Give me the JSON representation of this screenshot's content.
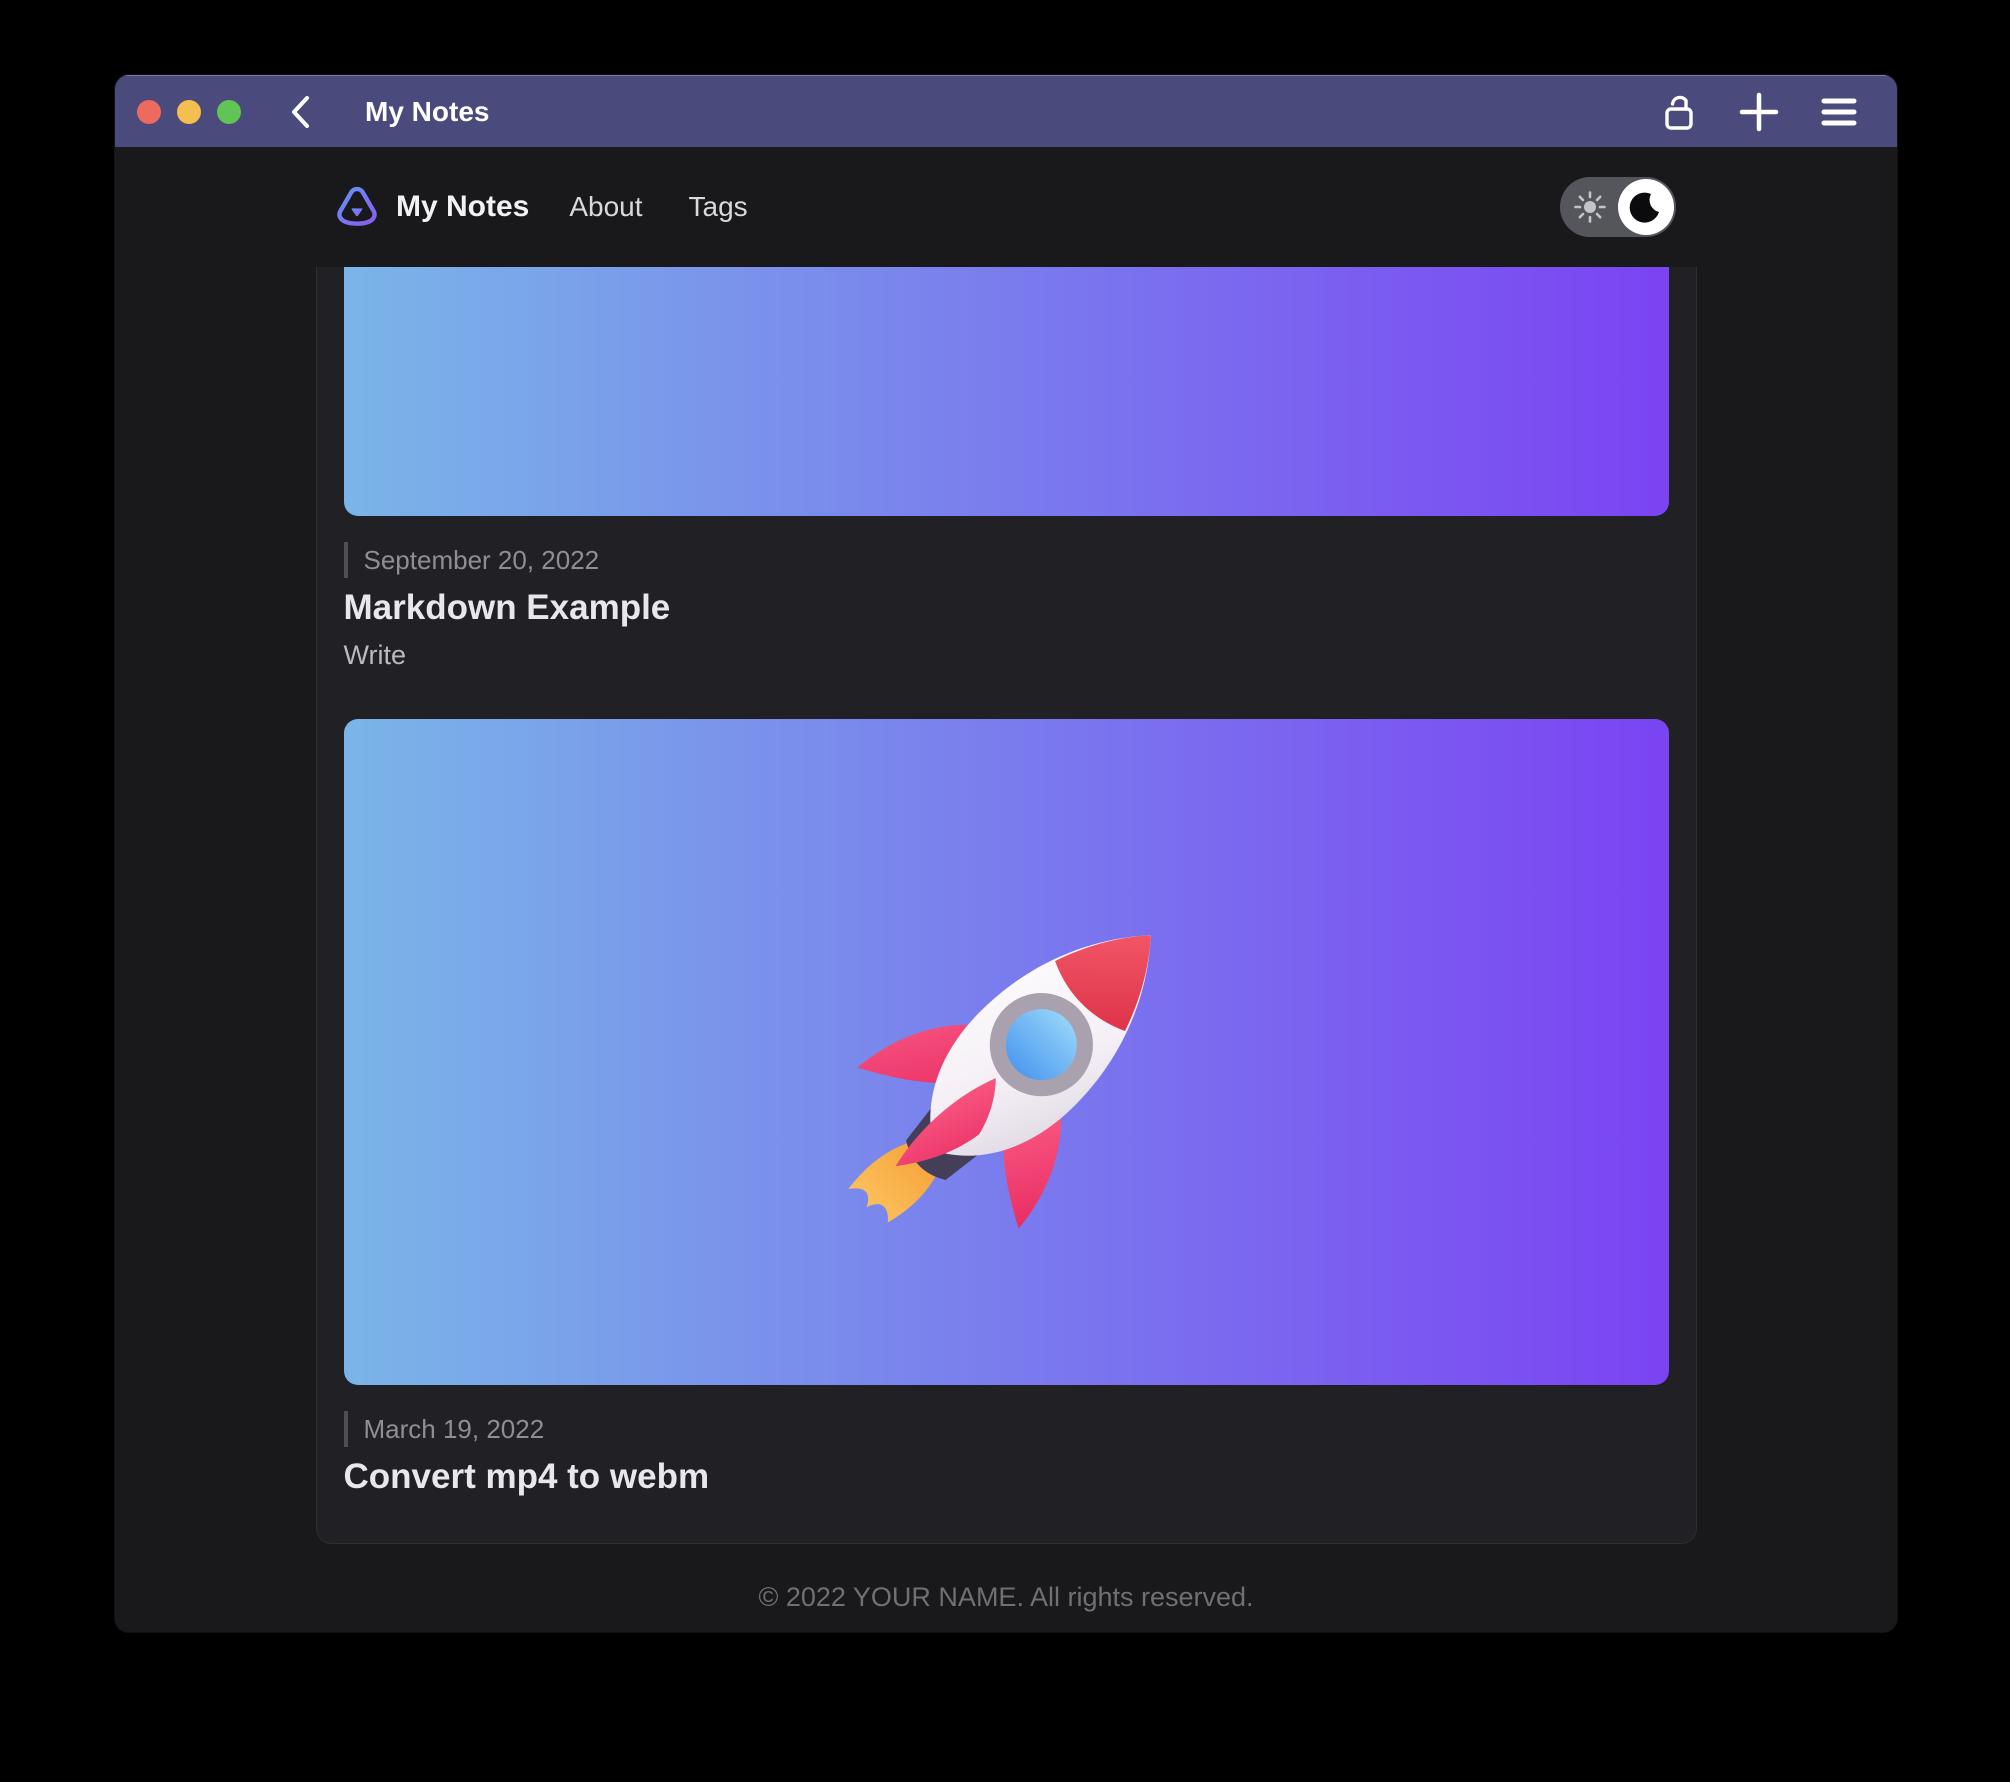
{
  "window": {
    "title": "My Notes",
    "titlebar_color": "#4b4a7c",
    "icons": {
      "back": "chevron-left",
      "lock": "lock-open",
      "add": "plus",
      "menu": "hamburger"
    }
  },
  "nav": {
    "brand": "My Notes",
    "links": [
      {
        "label": "About"
      },
      {
        "label": "Tags"
      }
    ],
    "theme_toggle": {
      "state": "dark",
      "icons": [
        "sun",
        "moon"
      ]
    }
  },
  "posts": [
    {
      "date": "September 20, 2022",
      "title": "Markdown Example",
      "excerpt": "Write",
      "banner": "blue-purple-gradient"
    },
    {
      "date": "March 19, 2022",
      "title": "Convert mp4 to webm",
      "banner": "blue-purple-gradient-rocket"
    }
  ],
  "footer": {
    "copyright": "© 2022 YOUR NAME. All rights reserved."
  },
  "colors": {
    "banner_gradient_start": "#7ab5e8",
    "banner_gradient_end": "#7b43f3",
    "titlebar": "#4b4a7c",
    "page_bg": "#19191c",
    "panel_bg": "#212125",
    "traffic_red": "#ed6a5e",
    "traffic_yellow": "#f4bf4f",
    "traffic_green": "#61c454"
  }
}
